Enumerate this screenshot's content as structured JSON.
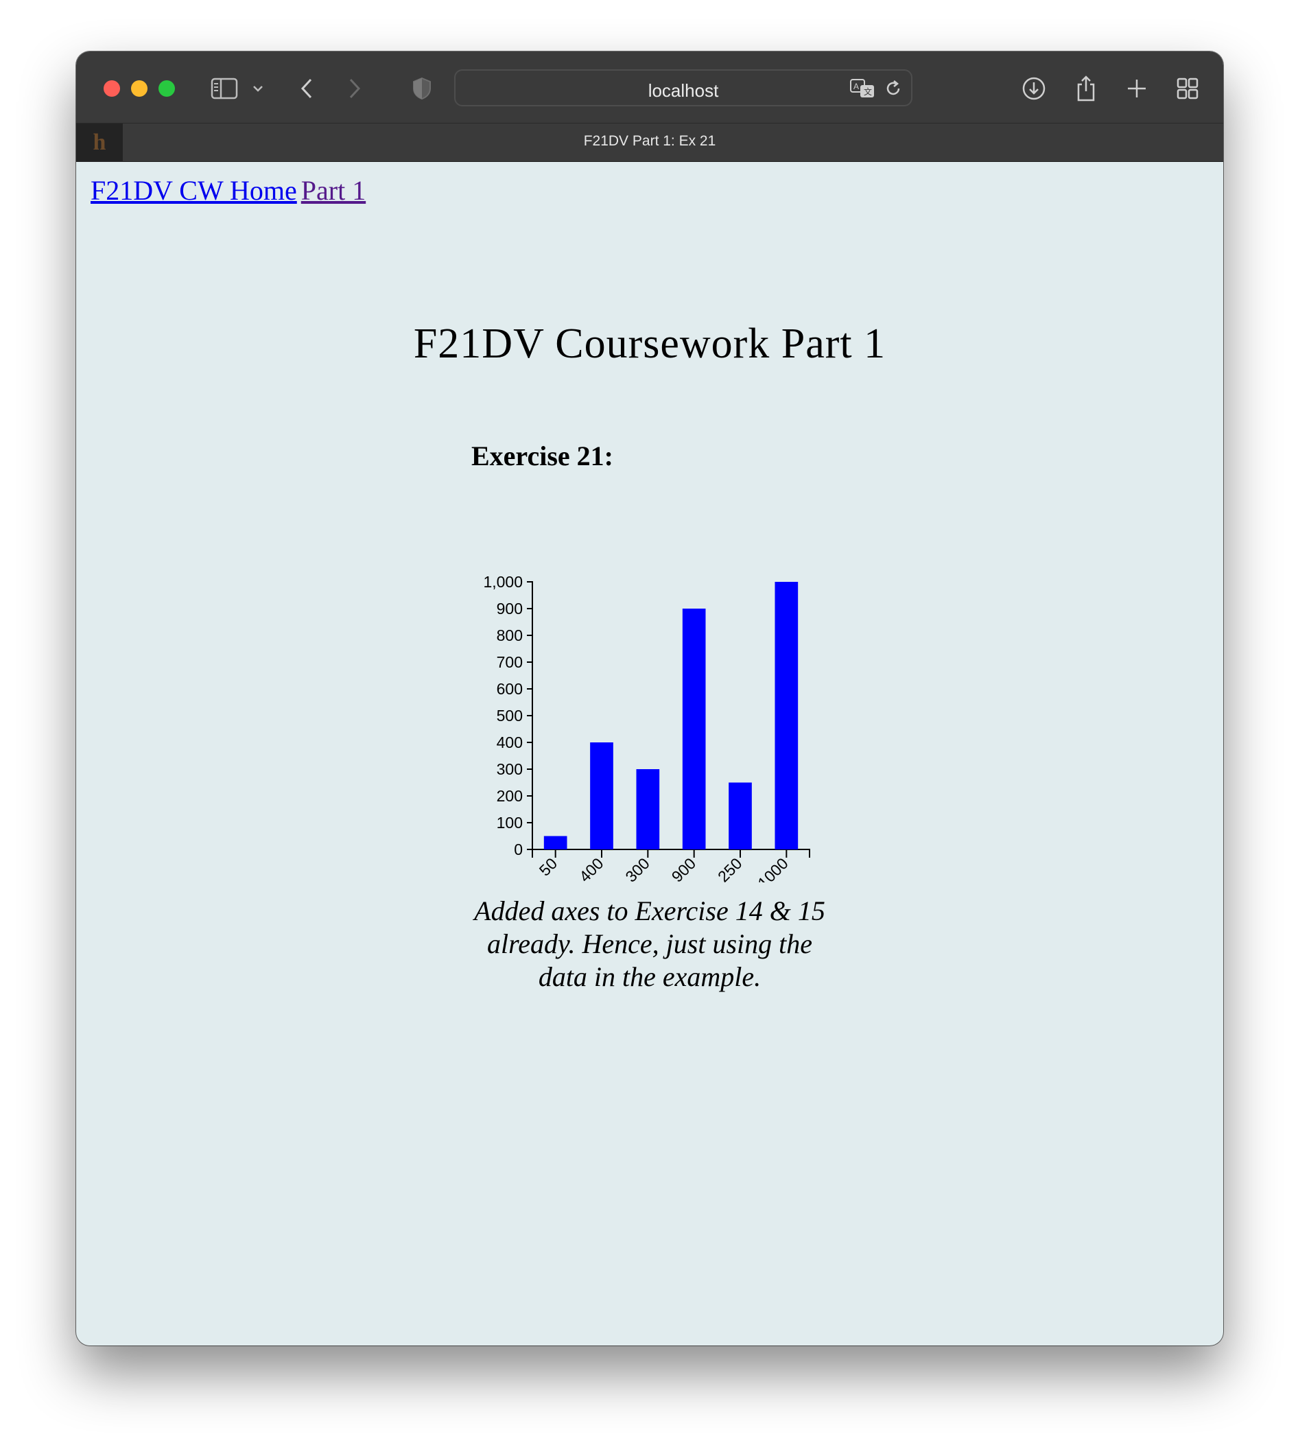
{
  "browser": {
    "address": "localhost",
    "tab_title": "F21DV Part 1: Ex 21",
    "favicon_letter": "h"
  },
  "nav": {
    "home_link": "F21DV CW Home",
    "part_link": "Part 1"
  },
  "page": {
    "title": "F21DV Coursework Part 1",
    "exercise_heading": "Exercise 21:",
    "note": "Added axes to Exercise 14 & 15 already. Hence, just using the data in the example."
  },
  "colors": {
    "bar": "#0000ff",
    "page_background": "#e1ecee",
    "link": "#0000ee",
    "visited_link": "#551a8b"
  },
  "chart_data": {
    "type": "bar",
    "categories": [
      "50",
      "400",
      "300",
      "900",
      "250",
      "1000"
    ],
    "values": [
      50,
      400,
      300,
      900,
      250,
      1000
    ],
    "ylim": [
      0,
      1000
    ],
    "yticks": [
      0,
      100,
      200,
      300,
      400,
      500,
      600,
      700,
      800,
      900,
      1000
    ],
    "ytick_labels": [
      "0",
      "100",
      "200",
      "300",
      "400",
      "500",
      "600",
      "700",
      "800",
      "900",
      "1,000"
    ],
    "title": "",
    "xlabel": "",
    "ylabel": "",
    "grid": false,
    "x_tick_rotation": "-45"
  }
}
